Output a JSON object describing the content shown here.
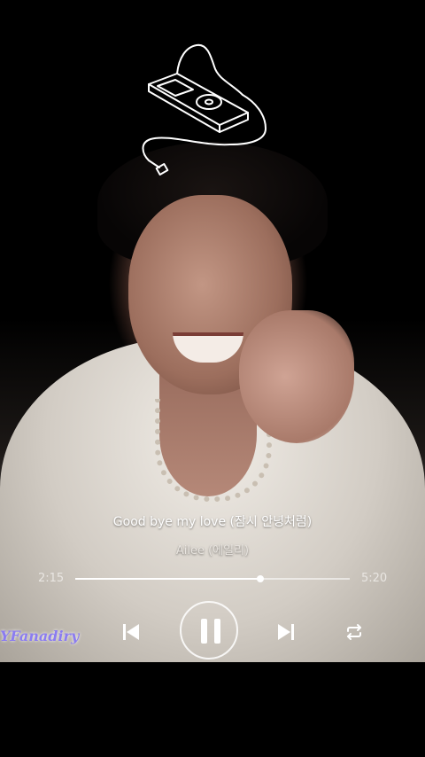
{
  "player": {
    "song_title": "Good bye my love (잠시 안녕처럼)",
    "artist": "Ailee (에일리)",
    "elapsed": "2:15",
    "total": "5:20",
    "progress_fraction": 0.675
  },
  "watermark": {
    "text": "YFanadiry"
  },
  "icons": {
    "sticker": "ipod-doodle-icon",
    "prev": "skip-previous-icon",
    "play_pause": "pause-icon",
    "next": "skip-next-icon",
    "repeat": "repeat-icon"
  },
  "colors": {
    "background": "#000000",
    "controls": "#ffffff",
    "watermark": "#8b7cf0"
  }
}
